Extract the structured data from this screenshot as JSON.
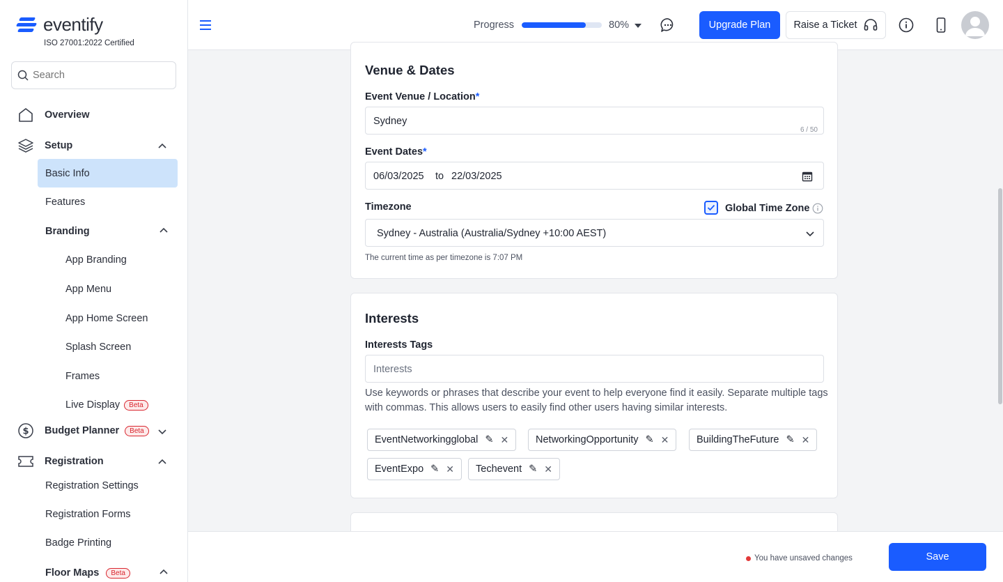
{
  "brand": {
    "name": "eventify",
    "certification": "ISO 27001:2022 Certified",
    "accent": "#1a5cff"
  },
  "search": {
    "placeholder": "Search"
  },
  "sidebar": {
    "overview": "Overview",
    "setup": "Setup",
    "basic_info": "Basic Info",
    "features": "Features",
    "branding": "Branding",
    "branding_items": [
      "App Branding",
      "App Menu",
      "App Home Screen",
      "Splash Screen",
      "Frames",
      "Live Display"
    ],
    "beta_label": "Beta",
    "budget_planner": "Budget Planner",
    "registration": "Registration",
    "registration_items": [
      "Registration Settings",
      "Registration Forms",
      "Badge Printing"
    ],
    "floor_maps": "Floor Maps"
  },
  "topbar": {
    "progress_label": "Progress",
    "progress_value": 0.8,
    "progress_text": "80%",
    "upgrade_label": "Upgrade Plan",
    "ticket_label": "Raise a Ticket"
  },
  "venue": {
    "title": "Venue & Dates",
    "location_label": "Event Venue / Location",
    "required_mark": "*",
    "location_value": "Sydney",
    "location_counter": "6 / 50",
    "dates_label": "Event Dates",
    "start_date": "06/03/2025",
    "to_text": "to",
    "end_date": "22/03/2025",
    "timezone_label": "Timezone",
    "global_tz_label": "Global Time Zone",
    "global_tz_checked": true,
    "timezone_value": "Sydney - Australia (Australia/Sydney +10:00 AEST)",
    "timezone_help": "The current time as per timezone is 7:07 PM"
  },
  "interests": {
    "title": "Interests",
    "tags_label": "Interests Tags",
    "placeholder": "Interests",
    "help": "Use keywords or phrases that describe your event to help everyone find it easily. Separate multiple tags with commas. This allows users to easily find other users having similar interests.",
    "tags": [
      "EventNetworkingglobal",
      "NetworkingOpportunity",
      "BuildingTheFuture",
      "EventExpo",
      "Techevent"
    ]
  },
  "footer": {
    "unsaved_text": "You have unsaved changes",
    "save_label": "Save"
  }
}
